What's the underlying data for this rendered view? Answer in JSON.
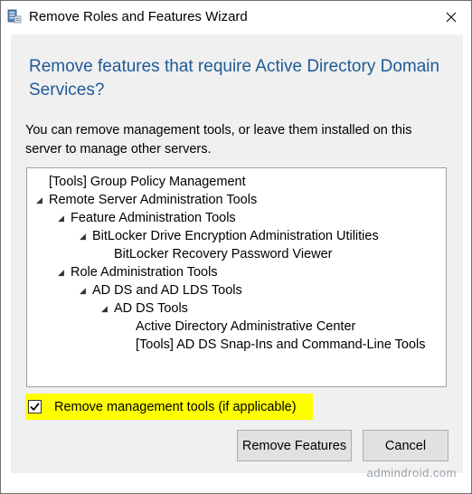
{
  "window": {
    "title": "Remove Roles and Features Wizard"
  },
  "dialog": {
    "heading": "Remove features that require Active Directory Domain Services?",
    "description": "You can remove management tools, or leave them installed on this server to manage other servers."
  },
  "tree": {
    "items": [
      {
        "label": "[Tools] Group Policy Management",
        "level": 0,
        "expanded": null
      },
      {
        "label": "Remote Server Administration Tools",
        "level": 0,
        "expanded": true
      },
      {
        "label": "Feature Administration Tools",
        "level": 1,
        "expanded": true
      },
      {
        "label": "BitLocker Drive Encryption Administration Utilities",
        "level": 2,
        "expanded": true
      },
      {
        "label": "BitLocker Recovery Password Viewer",
        "level": 3,
        "expanded": null
      },
      {
        "label": "Role Administration Tools",
        "level": 1,
        "expanded": true
      },
      {
        "label": "AD DS and AD LDS Tools",
        "level": 2,
        "expanded": true
      },
      {
        "label": "AD DS Tools",
        "level": 3,
        "expanded": true
      },
      {
        "label": "Active Directory Administrative Center",
        "level": 4,
        "expanded": null
      },
      {
        "label": "[Tools] AD DS Snap-Ins and Command-Line Tools",
        "level": 4,
        "expanded": null
      }
    ]
  },
  "options": {
    "remove_tools_label": "Remove management tools (if applicable)",
    "remove_tools_checked": true,
    "highlight_color": "#ffff00"
  },
  "buttons": {
    "remove_features": "Remove Features",
    "cancel": "Cancel"
  },
  "watermark": "admindroid.com",
  "colors": {
    "heading": "#1e5a96",
    "content_bg": "#f0f0f0"
  },
  "icons": {
    "app": "server-manager-icon",
    "close": "close-icon",
    "expanded": "triangle-expanded-icon",
    "check": "checkmark-icon"
  }
}
